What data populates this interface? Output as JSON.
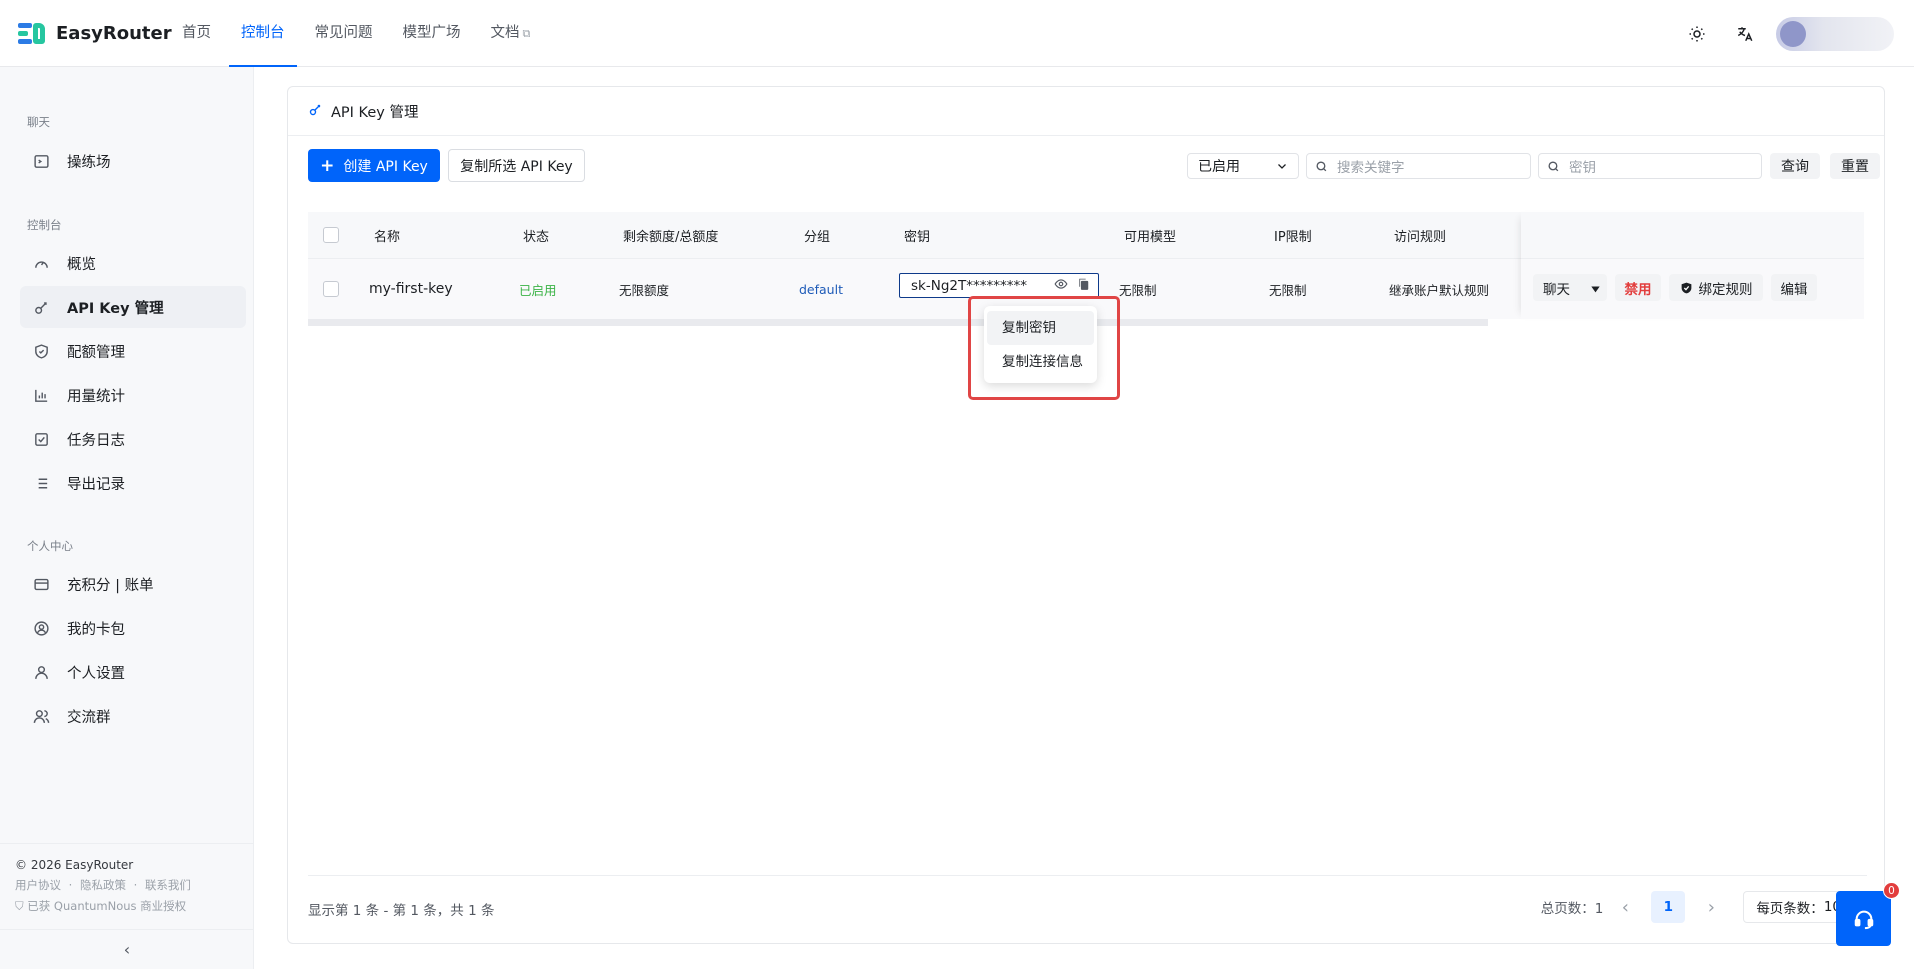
{
  "brand": {
    "name": "EasyRouter"
  },
  "nav": [
    {
      "label": "首页",
      "active": false
    },
    {
      "label": "控制台",
      "active": true
    },
    {
      "label": "常见问题",
      "active": false
    },
    {
      "label": "模型广场",
      "active": false
    },
    {
      "label": "文档",
      "active": false,
      "external": true
    }
  ],
  "sidebar": {
    "groups": [
      {
        "title": "聊天",
        "items": [
          {
            "label": "操练场",
            "icon": "terminal-icon"
          }
        ]
      },
      {
        "title": "控制台",
        "items": [
          {
            "label": "概览",
            "icon": "gauge-icon"
          },
          {
            "label": "API Key 管理",
            "icon": "key-icon",
            "active": true
          },
          {
            "label": "配额管理",
            "icon": "shield-icon"
          },
          {
            "label": "用量统计",
            "icon": "bar-chart-icon"
          },
          {
            "label": "任务日志",
            "icon": "checklist-icon"
          },
          {
            "label": "导出记录",
            "icon": "list-icon"
          }
        ]
      },
      {
        "title": "个人中心",
        "items": [
          {
            "label": "充积分 | 账单",
            "icon": "credit-card-icon"
          },
          {
            "label": "我的卡包",
            "icon": "wallet-icon"
          },
          {
            "label": "个人设置",
            "icon": "user-icon"
          },
          {
            "label": "交流群",
            "icon": "users-icon"
          }
        ]
      }
    ],
    "footer": {
      "copyright": "© 2026 EasyRouter",
      "links": [
        "用户协议",
        "·",
        "隐私政策",
        "·",
        "联系我们"
      ],
      "license": "已获 QuantumNous 商业授权"
    }
  },
  "panel": {
    "title": "API Key 管理",
    "toolbar": {
      "create_label": "创建 API Key",
      "copy_selected_label": "复制所选 API Key",
      "status_select_value": "已启用",
      "keyword_placeholder": "搜索关键字",
      "secret_placeholder": "密钥",
      "query_label": "查询",
      "reset_label": "重置"
    },
    "table": {
      "columns": [
        "名称",
        "状态",
        "剩余额度/总额度",
        "分组",
        "密钥",
        "可用模型",
        "IP限制",
        "访问规则"
      ],
      "rows": [
        {
          "name": "my-first-key",
          "status": "已启用",
          "quota": "无限额度",
          "group": "default",
          "key": "sk-Ng2T*********",
          "models": "无限制",
          "ip": "无限制",
          "rules": "继承账户默认规则",
          "actions": {
            "chat": "聊天",
            "disable": "禁用",
            "bind": "绑定规则",
            "edit": "编辑"
          }
        }
      ]
    },
    "copy_menu": [
      "复制密钥",
      "复制连接信息"
    ],
    "summary": "显示第 1 条 - 第 1 条，共 1 条",
    "pager": {
      "total_pages_label": "总页数：",
      "total_pages": "1",
      "current_page": "1",
      "per_page_label": "每页条数：",
      "per_page": "10"
    }
  },
  "support": {
    "badge_count": "0"
  },
  "colors": {
    "primary": "#0064fa",
    "danger": "#e23d3d",
    "success": "#3bb346",
    "highlight_box": "#e04545"
  }
}
